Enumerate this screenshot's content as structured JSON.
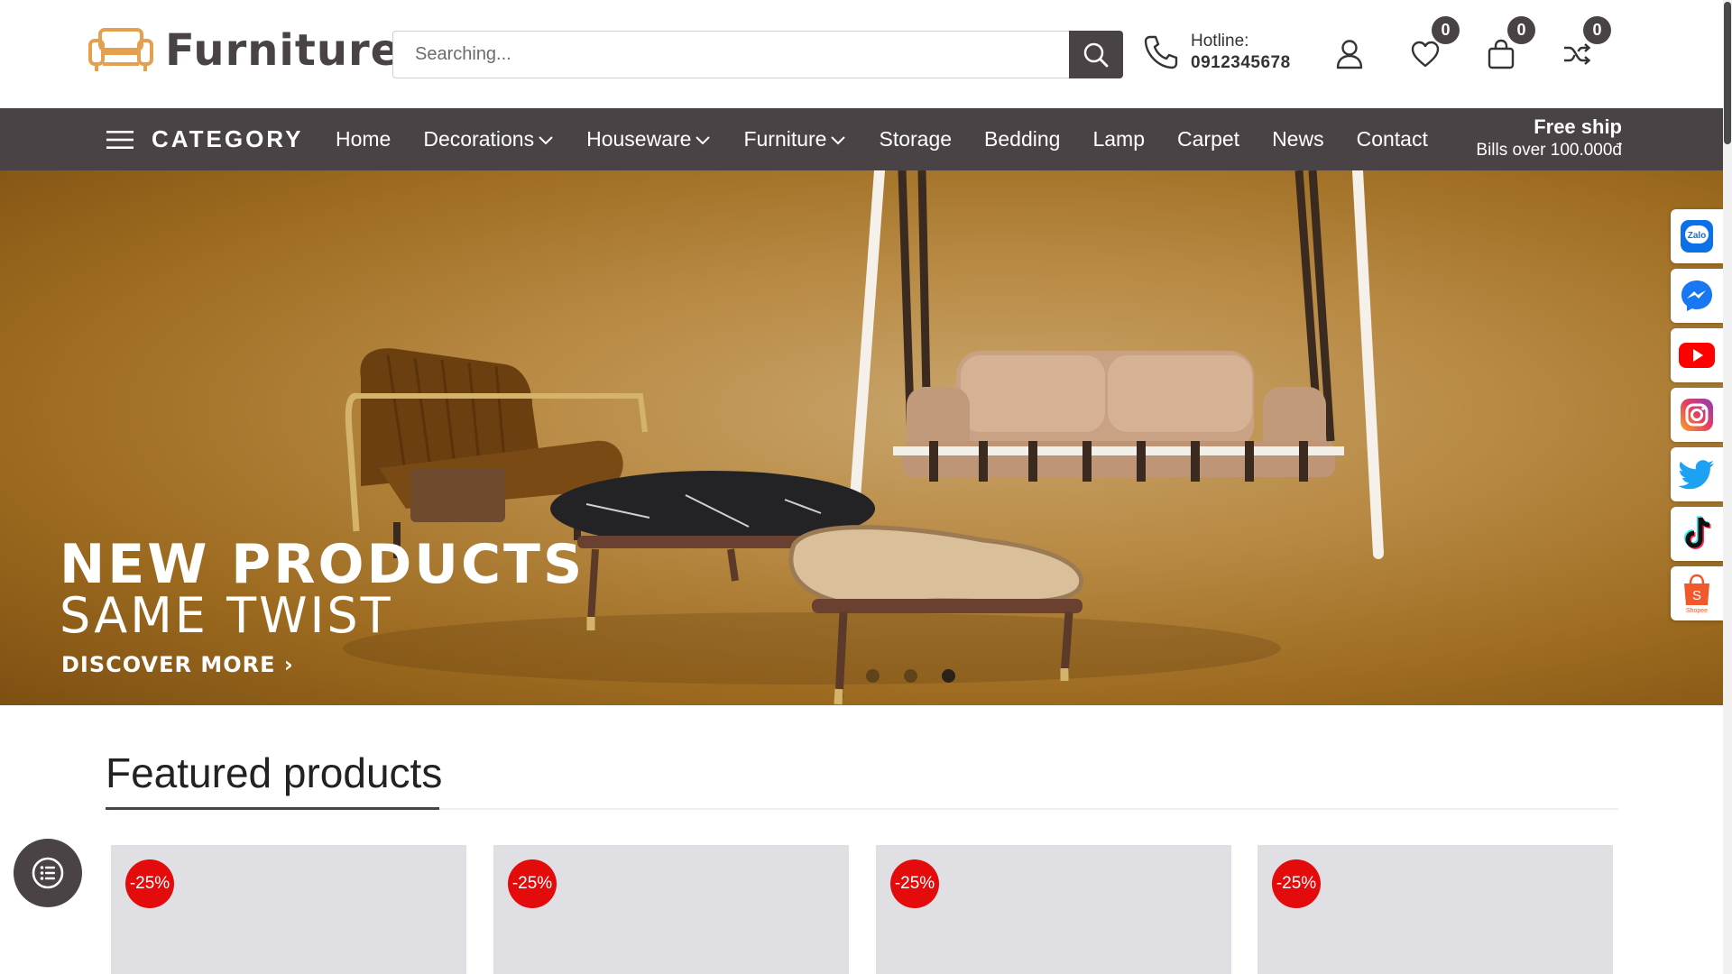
{
  "header": {
    "logo_text": "Furniture",
    "search": {
      "placeholder": "Searching..."
    },
    "hotline": {
      "label": "Hotline:",
      "number": "0912345678"
    },
    "wishlist_count": "0",
    "cart_count": "0",
    "compare_count": "0",
    "icons": [
      "search-icon",
      "phone-icon",
      "user-icon",
      "heart-icon",
      "bag-icon",
      "shuffle-icon"
    ]
  },
  "nav": {
    "category_label": "CATEGORY",
    "items": [
      {
        "label": "Home",
        "dropdown": false
      },
      {
        "label": "Decorations",
        "dropdown": true
      },
      {
        "label": "Houseware",
        "dropdown": true
      },
      {
        "label": "Furniture",
        "dropdown": true
      },
      {
        "label": "Storage",
        "dropdown": false
      },
      {
        "label": "Bedding",
        "dropdown": false
      },
      {
        "label": "Lamp",
        "dropdown": false
      },
      {
        "label": "Carpet",
        "dropdown": false
      },
      {
        "label": "News",
        "dropdown": false
      },
      {
        "label": "Contact",
        "dropdown": false
      }
    ],
    "promo_title": "Free ship",
    "promo_sub": "Bills over 100.000đ"
  },
  "banner": {
    "title": "NEW PRODUCTS",
    "subtitle": "SAME TWIST",
    "cta": "DISCOVER MORE",
    "slides": 3,
    "active_slide": 3
  },
  "social": {
    "zalo_label": "Zalo",
    "shopee_label": "Shopee",
    "items": [
      "zalo-icon",
      "messenger-icon",
      "youtube-icon",
      "instagram-icon",
      "twitter-icon",
      "tiktok-icon",
      "shopee-icon"
    ]
  },
  "featured": {
    "title": "Featured products",
    "products": [
      {
        "discount": "-25%"
      },
      {
        "discount": "-25%"
      },
      {
        "discount": "-25%"
      },
      {
        "discount": "-25%"
      }
    ]
  },
  "colors": {
    "brand": "#4a4346",
    "accent_logo": "#e3a04e",
    "discount": "#e30b0b",
    "banner_bg": "#b88a44"
  }
}
